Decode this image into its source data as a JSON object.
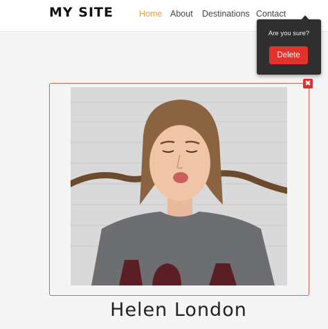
{
  "header": {
    "logo": "MY SITE",
    "nav": [
      {
        "label": "Home",
        "active": true
      },
      {
        "label": "About",
        "active": false
      },
      {
        "label": "Destinations",
        "active": false
      },
      {
        "label": "Contact",
        "active": false
      }
    ]
  },
  "card": {
    "close_icon": "close-icon",
    "person_name": "Helen London"
  },
  "popover": {
    "question": "Are you sure?",
    "delete_label": "Delete"
  },
  "colors": {
    "accent": "#e8a13a",
    "danger": "#e3322b",
    "card_border": "#e85a5a",
    "popover_bg": "#2f2f2f"
  }
}
